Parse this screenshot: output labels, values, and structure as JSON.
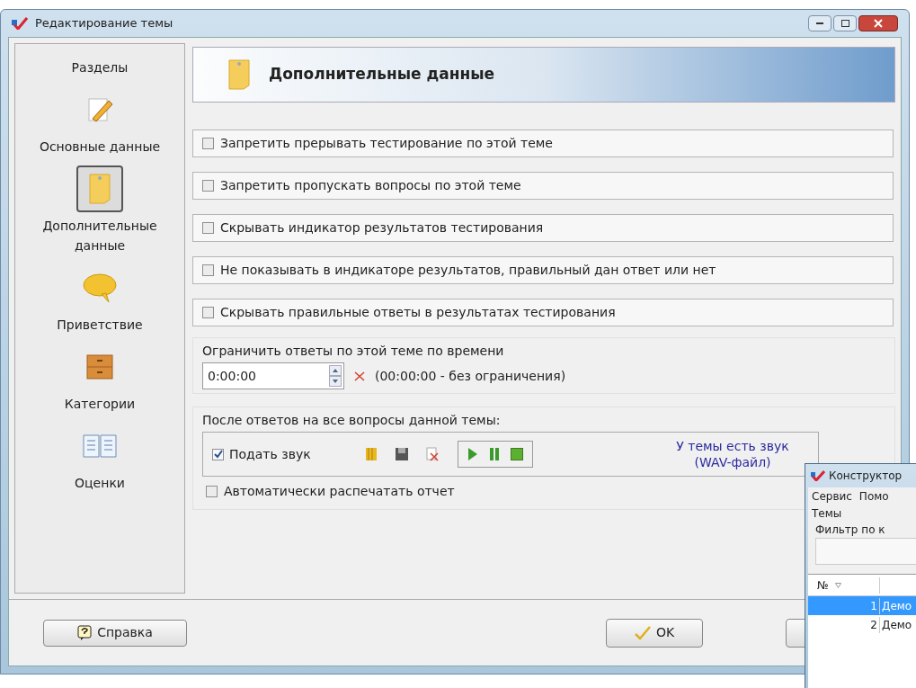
{
  "window": {
    "title": "Редактирование темы"
  },
  "sidebar": {
    "title": "Разделы",
    "items": [
      {
        "label": "Основные данные",
        "kind": "pencil",
        "selected": false
      },
      {
        "label": "Дополнительные данные",
        "kind": "note",
        "selected": true
      },
      {
        "label": "Приветствие",
        "kind": "speech",
        "selected": false
      },
      {
        "label": "Категории",
        "kind": "cabinet",
        "selected": false
      },
      {
        "label": "Оценки",
        "kind": "book",
        "selected": false
      }
    ]
  },
  "header": {
    "title": "Дополнительные данные"
  },
  "options": [
    {
      "label": "Запретить прерывать тестирование по этой теме",
      "checked": false
    },
    {
      "label": "Запретить пропускать вопросы по этой теме",
      "checked": false
    },
    {
      "label": "Скрывать индикатор результатов тестирования",
      "checked": false
    },
    {
      "label": "Не показывать в индикаторе результатов, правильный дан ответ или нет",
      "checked": false
    },
    {
      "label": "Скрывать правильные ответы в результатах тестирования",
      "checked": false
    }
  ],
  "time_limit": {
    "label": "Ограничить ответы по этой теме по времени",
    "value": "0:00:00",
    "hint": "(00:00:00 - без ограничения)"
  },
  "after": {
    "label": "После ответов на все вопросы данной темы:",
    "sound": {
      "label": "Подать звук",
      "checked": true,
      "status": "У темы есть звук (WAV-файл)"
    },
    "print": {
      "label": "Автоматически распечатать отчет",
      "checked": false
    }
  },
  "buttons": {
    "help": "Справка",
    "ok": "OK"
  },
  "second_window": {
    "title": "Конструктор",
    "menu": [
      "Сервис",
      "Помо"
    ],
    "section": "Темы",
    "filter_label": "Фильтр по к",
    "column": "№",
    "rows": [
      {
        "number": "1",
        "name": "Демо",
        "selected": true
      },
      {
        "number": "2",
        "name": "Демо",
        "selected": false
      }
    ]
  }
}
